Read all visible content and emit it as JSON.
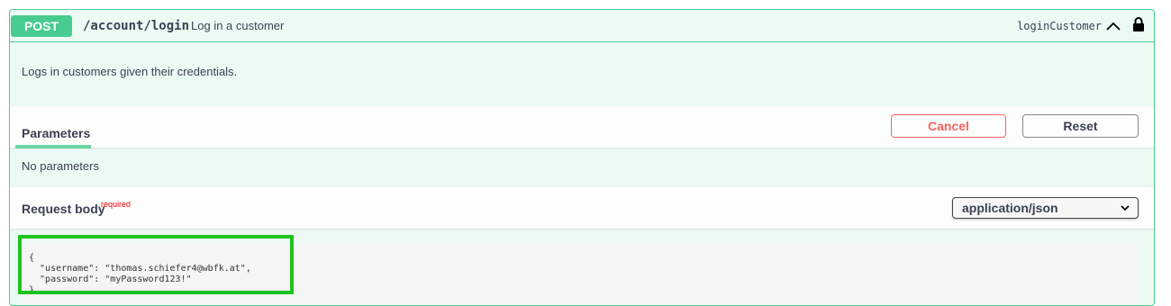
{
  "operation": {
    "method": "POST",
    "path": "/account/login",
    "summary": "Log in a customer",
    "operation_id": "loginCustomer",
    "description": "Logs in customers given their credentials."
  },
  "parameters": {
    "tab_label": "Parameters",
    "cancel_label": "Cancel",
    "reset_label": "Reset",
    "empty_text": "No parameters"
  },
  "request_body": {
    "title": "Request body",
    "required_label": "required",
    "content_type": "application/json",
    "example": "{\n  \"username\": \"thomas.schiefer4@wbfk.at\",\n  \"password\": \"myPassword123!\"\n}"
  },
  "colors": {
    "post_green": "#49cc90",
    "cancel_red": "#ff6060",
    "highlight_green": "#1ec31e"
  },
  "icons": {
    "collapse": "chevron-up-icon",
    "auth": "lock-icon",
    "select": "chevron-down-icon"
  }
}
